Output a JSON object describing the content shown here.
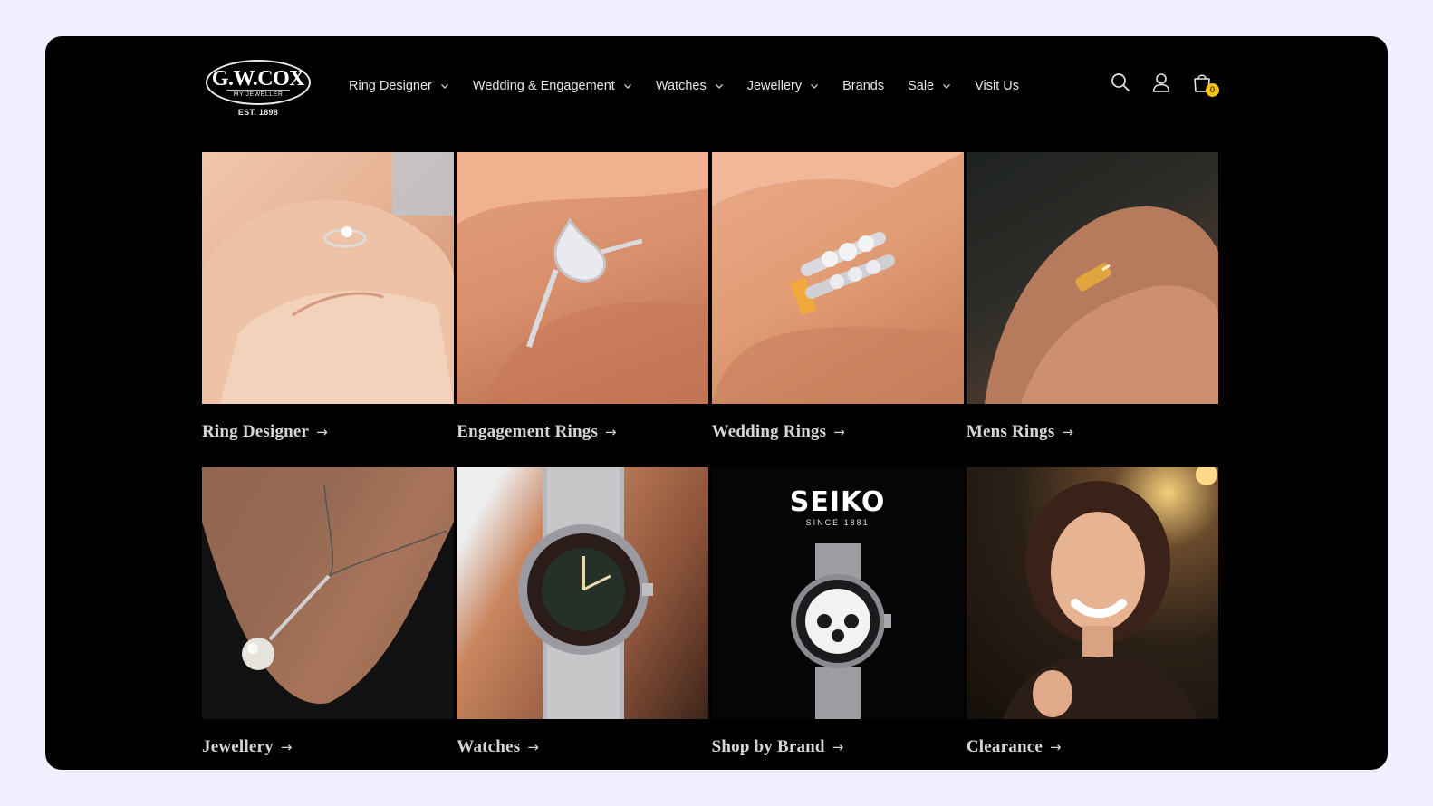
{
  "brand": {
    "logo_main": "G.W.COX",
    "logo_sub": "MY JEWELLER",
    "logo_est": "EST. 1898",
    "accent_color": "#f3c318"
  },
  "nav": {
    "items": [
      {
        "label": "Ring Designer",
        "has_dropdown": true
      },
      {
        "label": "Wedding & Engagement",
        "has_dropdown": true
      },
      {
        "label": "Watches",
        "has_dropdown": true
      },
      {
        "label": "Jewellery",
        "has_dropdown": true
      },
      {
        "label": "Brands",
        "has_dropdown": false
      },
      {
        "label": "Sale",
        "has_dropdown": true
      },
      {
        "label": "Visit Us",
        "has_dropdown": false
      }
    ]
  },
  "header_icons": {
    "search": "search-icon",
    "account": "account-icon",
    "cart": "cart-icon",
    "cart_count": "0"
  },
  "categories": [
    {
      "label": "Ring Designer",
      "image": "hand with solitaire ring"
    },
    {
      "label": "Engagement Rings",
      "image": "pear halo ring on finger"
    },
    {
      "label": "Wedding Rings",
      "image": "stacked diamond bands"
    },
    {
      "label": "Mens Rings",
      "image": "men's gold band"
    },
    {
      "label": "Jewellery",
      "image": "pearl pendant necklace"
    },
    {
      "label": "Watches",
      "image": "dive watch on wrist"
    },
    {
      "label": "Shop by Brand",
      "image": "seiko chronograph"
    },
    {
      "label": "Clearance",
      "image": "smiling woman"
    }
  ],
  "seiko_tile": {
    "wordmark": "SEIKO",
    "since": "SINCE 1881"
  },
  "arrow_glyph": "→"
}
